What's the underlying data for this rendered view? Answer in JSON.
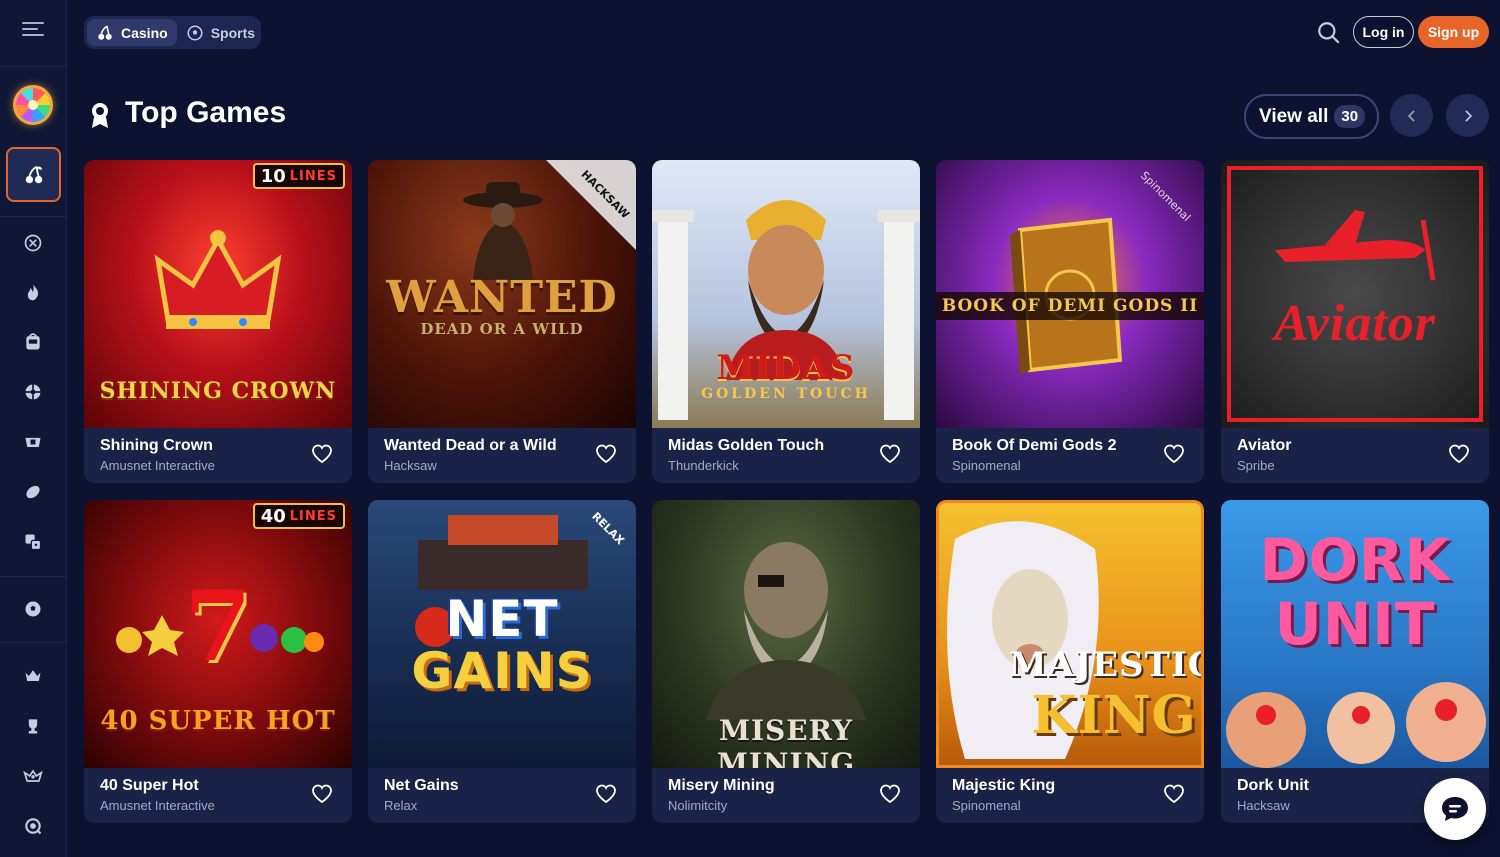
{
  "header": {
    "modes": [
      {
        "label": "Casino",
        "icon": "cherries-icon",
        "active": true
      },
      {
        "label": "Sports",
        "icon": "soccer-ball-icon",
        "active": false
      }
    ],
    "login_label": "Log in",
    "signup_label": "Sign up"
  },
  "sidebar": {
    "items": [
      {
        "name": "casino",
        "icon": "cherries-icon"
      },
      {
        "name": "live",
        "icon": "target-icon"
      },
      {
        "name": "hot",
        "icon": "fire-icon"
      },
      {
        "name": "slots",
        "icon": "slot-machine-icon"
      },
      {
        "name": "roulette",
        "icon": "roulette-icon"
      },
      {
        "name": "table-games",
        "icon": "card-table-icon"
      },
      {
        "name": "sports-ball",
        "icon": "rugby-ball-icon"
      },
      {
        "name": "game-shows",
        "icon": "dice-icon"
      },
      {
        "name": "sports",
        "icon": "soccer-ball-icon"
      },
      {
        "name": "vip",
        "icon": "crown-icon"
      },
      {
        "name": "tournaments",
        "icon": "trophy-icon"
      },
      {
        "name": "promotions",
        "icon": "rank-icon"
      },
      {
        "name": "support",
        "icon": "headset-icon"
      }
    ]
  },
  "section": {
    "title": "Top Games",
    "view_all_label": "View all",
    "view_all_count": "30"
  },
  "games": [
    {
      "title": "Shining Crown",
      "provider": "Amusnet Interactive",
      "art_text": "SHINING CROWN",
      "badge_num": "10",
      "badge_word": "LINES",
      "accent": "#c8141a"
    },
    {
      "title": "Wanted Dead or a Wild",
      "provider": "Hacksaw",
      "art_text": "WANTED",
      "art_sub": "DEAD OR A WILD",
      "corner": "HACKSAW",
      "accent": "#7a1a10"
    },
    {
      "title": "Midas Golden Touch",
      "provider": "Thunderkick",
      "art_text": "MIDAS",
      "art_sub": "GOLDEN TOUCH",
      "accent": "#c9d3e6"
    },
    {
      "title": "Book Of Demi Gods 2",
      "provider": "Spinomenal",
      "art_text": "BOOK OF DEMI GODS II",
      "corner": "Spinomenal",
      "accent": "#6a1fa0"
    },
    {
      "title": "Aviator",
      "provider": "Spribe",
      "art_text": "Aviator",
      "accent": "#e8202a"
    },
    {
      "title": "40 Super Hot",
      "provider": "Amusnet Interactive",
      "art_text": "40 SUPER HOT",
      "badge_num": "40",
      "badge_word": "LINES",
      "accent": "#a40f12"
    },
    {
      "title": "Net Gains",
      "provider": "Relax",
      "art_text": "NET",
      "art_sub": "GAINS",
      "corner": "RELAX",
      "accent": "#1f4f86"
    },
    {
      "title": "Misery Mining",
      "provider": "Nolimitcity",
      "art_text": "MISERY MINING",
      "accent": "#3e4a2c"
    },
    {
      "title": "Majestic King",
      "provider": "Spinomenal",
      "art_text": "MAJESTIC",
      "art_sub": "KING",
      "accent": "#d88a1a"
    },
    {
      "title": "Dork Unit",
      "provider": "Hacksaw",
      "art_text": "DORK",
      "art_sub": "UNIT",
      "accent": "#2a7ed8"
    }
  ]
}
